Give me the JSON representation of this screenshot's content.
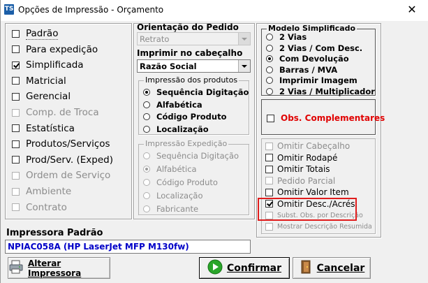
{
  "window": {
    "title": "Opções de Impressão - Orçamento",
    "icon": "app-logo-icon",
    "close": "✕"
  },
  "left_options": [
    {
      "label": "Padrão",
      "checked": false,
      "enabled": true
    },
    {
      "label": "Para expedição",
      "checked": false,
      "enabled": true
    },
    {
      "label": "Simplificada",
      "checked": true,
      "enabled": true
    },
    {
      "label": "Matricial",
      "checked": false,
      "enabled": true
    },
    {
      "label": "Gerencial",
      "checked": false,
      "enabled": true
    },
    {
      "label": "Comp. de Troca",
      "checked": false,
      "enabled": false
    },
    {
      "label": "Estatística",
      "checked": false,
      "enabled": true
    },
    {
      "label": "Produtos/Serviços",
      "checked": false,
      "enabled": true
    },
    {
      "label": "Prod/Serv. (Exped)",
      "checked": false,
      "enabled": true
    },
    {
      "label": "Ordem de Serviço",
      "checked": false,
      "enabled": false
    },
    {
      "label": "Ambiente",
      "checked": false,
      "enabled": false
    },
    {
      "label": "Contrato",
      "checked": false,
      "enabled": false
    }
  ],
  "orientacao": {
    "label": "Orientação do Pedido",
    "value": "Retrato",
    "enabled": false
  },
  "cabecalho": {
    "label": "Imprimir no cabeçalho",
    "value": "Razão Social"
  },
  "impressao_produtos": {
    "title": "Impressão dos produtos",
    "options": [
      "Sequência Digitação",
      "Alfabética",
      "Código Produto",
      "Localização"
    ],
    "selected": "Sequência Digitação"
  },
  "impressao_expedicao": {
    "title": "Impressão Expedição",
    "options": [
      "Sequência Digitação",
      "Alfabética",
      "Código Produto",
      "Localização",
      "Fabricante"
    ],
    "selected": "Alfabética",
    "enabled": false
  },
  "modelo_simplificado": {
    "title": "Modelo Simplificado",
    "options": [
      "2 Vias",
      "2 Vias / Com Desc.",
      "Com Devolução",
      "Barras / MVA",
      "Imprimir Imagem",
      "2 Vias / Multiplicador"
    ],
    "selected": "Com Devolução"
  },
  "obs_complementares": {
    "label": "Obs. Complementares",
    "checked": false
  },
  "right_options": [
    {
      "label": "Omitir Cabeçalho",
      "checked": false,
      "enabled": false
    },
    {
      "label": "Omitir Rodapé",
      "checked": false,
      "enabled": true
    },
    {
      "label": "Omitir Totais",
      "checked": false,
      "enabled": true
    },
    {
      "label": "Pedido Parcial",
      "checked": false,
      "enabled": false
    },
    {
      "label": "Omitir Valor Item",
      "checked": false,
      "enabled": true
    },
    {
      "label": "Omitir Desc./Acrés.",
      "checked": true,
      "enabled": true
    },
    {
      "label": "Subst. Obs. por Descrição",
      "checked": false,
      "enabled": false
    },
    {
      "label": "Mostrar Descrição Resumida",
      "checked": false,
      "enabled": false
    }
  ],
  "printer": {
    "label": "Impressora Padrão",
    "value": "NPIAC058A (HP LaserJet MFP M130fw)"
  },
  "buttons": {
    "alterar": "Alterar Impressora",
    "confirmar": "Confirmar",
    "cancelar": "Cancelar"
  },
  "colors": {
    "highlight_box": "#e01c1c",
    "printer_text": "#0000c8",
    "obs_text": "#e00000"
  }
}
